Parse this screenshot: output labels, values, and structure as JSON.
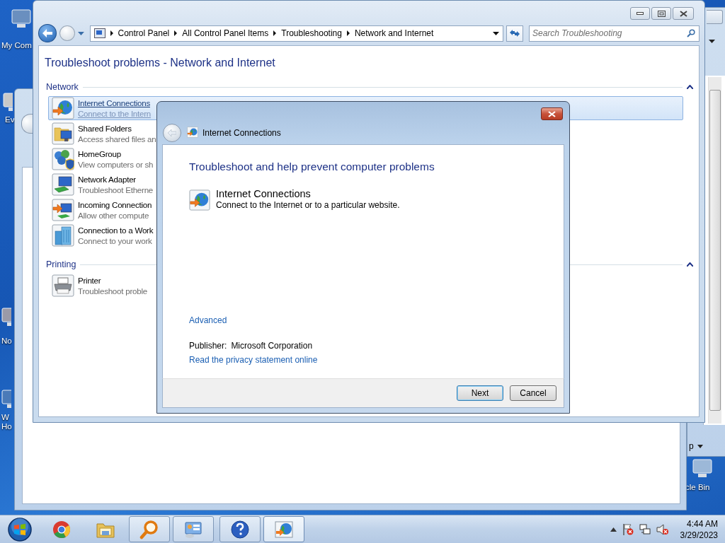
{
  "desktop_icons": [
    {
      "label": "My Com"
    },
    {
      "label": "Ev"
    },
    {
      "label": "No"
    },
    {
      "label": "W\nHo"
    },
    {
      "label": "cle Bin"
    }
  ],
  "background_window": {
    "menu_label": "p"
  },
  "explorer": {
    "breadcrumb": [
      "Control Panel",
      "All Control Panel Items",
      "Troubleshooting",
      "Network and Internet"
    ],
    "search": {
      "placeholder": "Search Troubleshooting"
    },
    "heading": "Troubleshoot problems - Network and Internet",
    "groups": [
      {
        "name": "Network",
        "expanded": true,
        "items": [
          {
            "kind": "globe",
            "title": "Internet Connections",
            "description": "Connect to the Intern",
            "selected": true
          },
          {
            "kind": "folder",
            "title": "Shared Folders",
            "description": "Access shared files an",
            "selected": false
          },
          {
            "kind": "homegroup",
            "title": "HomeGroup",
            "description": "View computers or sh",
            "selected": false
          },
          {
            "kind": "adapter",
            "title": "Network Adapter",
            "description": "Troubleshoot Etherne",
            "selected": false
          },
          {
            "kind": "incoming",
            "title": "Incoming Connection",
            "description": "Allow other compute",
            "selected": false
          },
          {
            "kind": "workplace",
            "title": "Connection to a Work",
            "description": "Connect to your work",
            "selected": false
          }
        ]
      },
      {
        "name": "Printing",
        "expanded": true,
        "items": [
          {
            "kind": "printer",
            "title": "Printer",
            "description": "Troubleshoot proble",
            "selected": false
          }
        ]
      }
    ]
  },
  "dialog": {
    "title": "Internet Connections",
    "heading": "Troubleshoot and help prevent computer problems",
    "item": {
      "title": "Internet Connections",
      "description": "Connect to the Internet or to a particular website."
    },
    "advanced_link": "Advanced",
    "publisher_label": "Publisher:",
    "publisher": "Microsoft Corporation",
    "privacy_link": "Read the privacy statement online",
    "buttons": [
      {
        "label": "Next",
        "kind": "default"
      },
      {
        "label": "Cancel",
        "kind": "normal"
      }
    ]
  },
  "taskbar": {
    "apps": [
      {
        "kind": "browser",
        "running": false,
        "selected": false
      },
      {
        "kind": "folder",
        "running": false,
        "selected": false
      },
      {
        "kind": "magnifier",
        "running": true,
        "selected": false
      },
      {
        "kind": "dashboard",
        "running": true,
        "selected": false
      },
      {
        "kind": "help",
        "running": true,
        "selected": false
      },
      {
        "kind": "globe",
        "running": true,
        "selected": true
      }
    ],
    "clock": {
      "time": "4:44 AM",
      "date": "3/29/2023"
    }
  }
}
